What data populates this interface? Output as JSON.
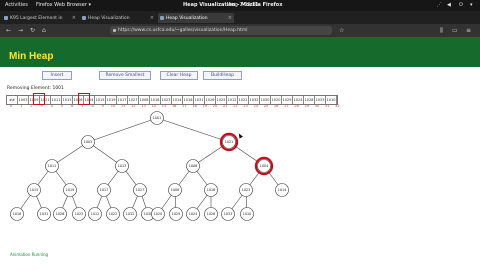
{
  "system": {
    "activities": "Activities",
    "app_menu": "Firefox Web Browser ▾",
    "clock": "Aug 7  09:11",
    "window_title": "Heap Visualization - Mozilla Firefox"
  },
  "tabs": [
    {
      "label": "K95 Largest Element in"
    },
    {
      "label": "Heap Visualization"
    },
    {
      "label": "Heap Visualization"
    }
  ],
  "url": "https://www.cs.usfca.edu/~galles/visualization/Heap.html",
  "page": {
    "title": "Min Heap",
    "status": "Removing Element: 1001"
  },
  "buttons": [
    "Insert",
    "Remove Smallest",
    "Clear Heap",
    "BuildHeap"
  ],
  "array_values": [
    "##",
    "1003",
    "1009",
    "1021",
    "1011",
    "1013",
    "1006",
    "1004",
    "1015",
    "1019",
    "1017",
    "1027",
    "1008",
    "1018",
    "1023",
    "1014",
    "1016",
    "1031",
    "1026",
    "1025",
    "1012",
    "1022",
    "1032",
    "1030",
    "1020",
    "1029",
    "1024",
    "1028",
    "1033",
    "1010"
  ],
  "array_indices": [
    "0",
    "1",
    "2",
    "3",
    "4",
    "5",
    "6",
    "7",
    "8",
    "9",
    "10",
    "11",
    "12",
    "13",
    "14",
    "15",
    "16",
    "17",
    "18",
    "19",
    "20",
    "21",
    "22",
    "23",
    "24",
    "25",
    "26",
    "27",
    "28",
    "29",
    "30",
    "31",
    "32"
  ],
  "tree_nodes": [
    "1001",
    "1003",
    "1021",
    "1011",
    "1013",
    "1006",
    "1004",
    "1015",
    "1019",
    "1017",
    "1027",
    "1008",
    "1018",
    "1023",
    "1014",
    "1016",
    "1031",
    "1026",
    "1025",
    "1012",
    "1022",
    "1032",
    "1030",
    "1020",
    "1029",
    "1024",
    "1028",
    "1033",
    "1010"
  ],
  "highlight_color": "#c40f1a",
  "footer": "Animation Running"
}
